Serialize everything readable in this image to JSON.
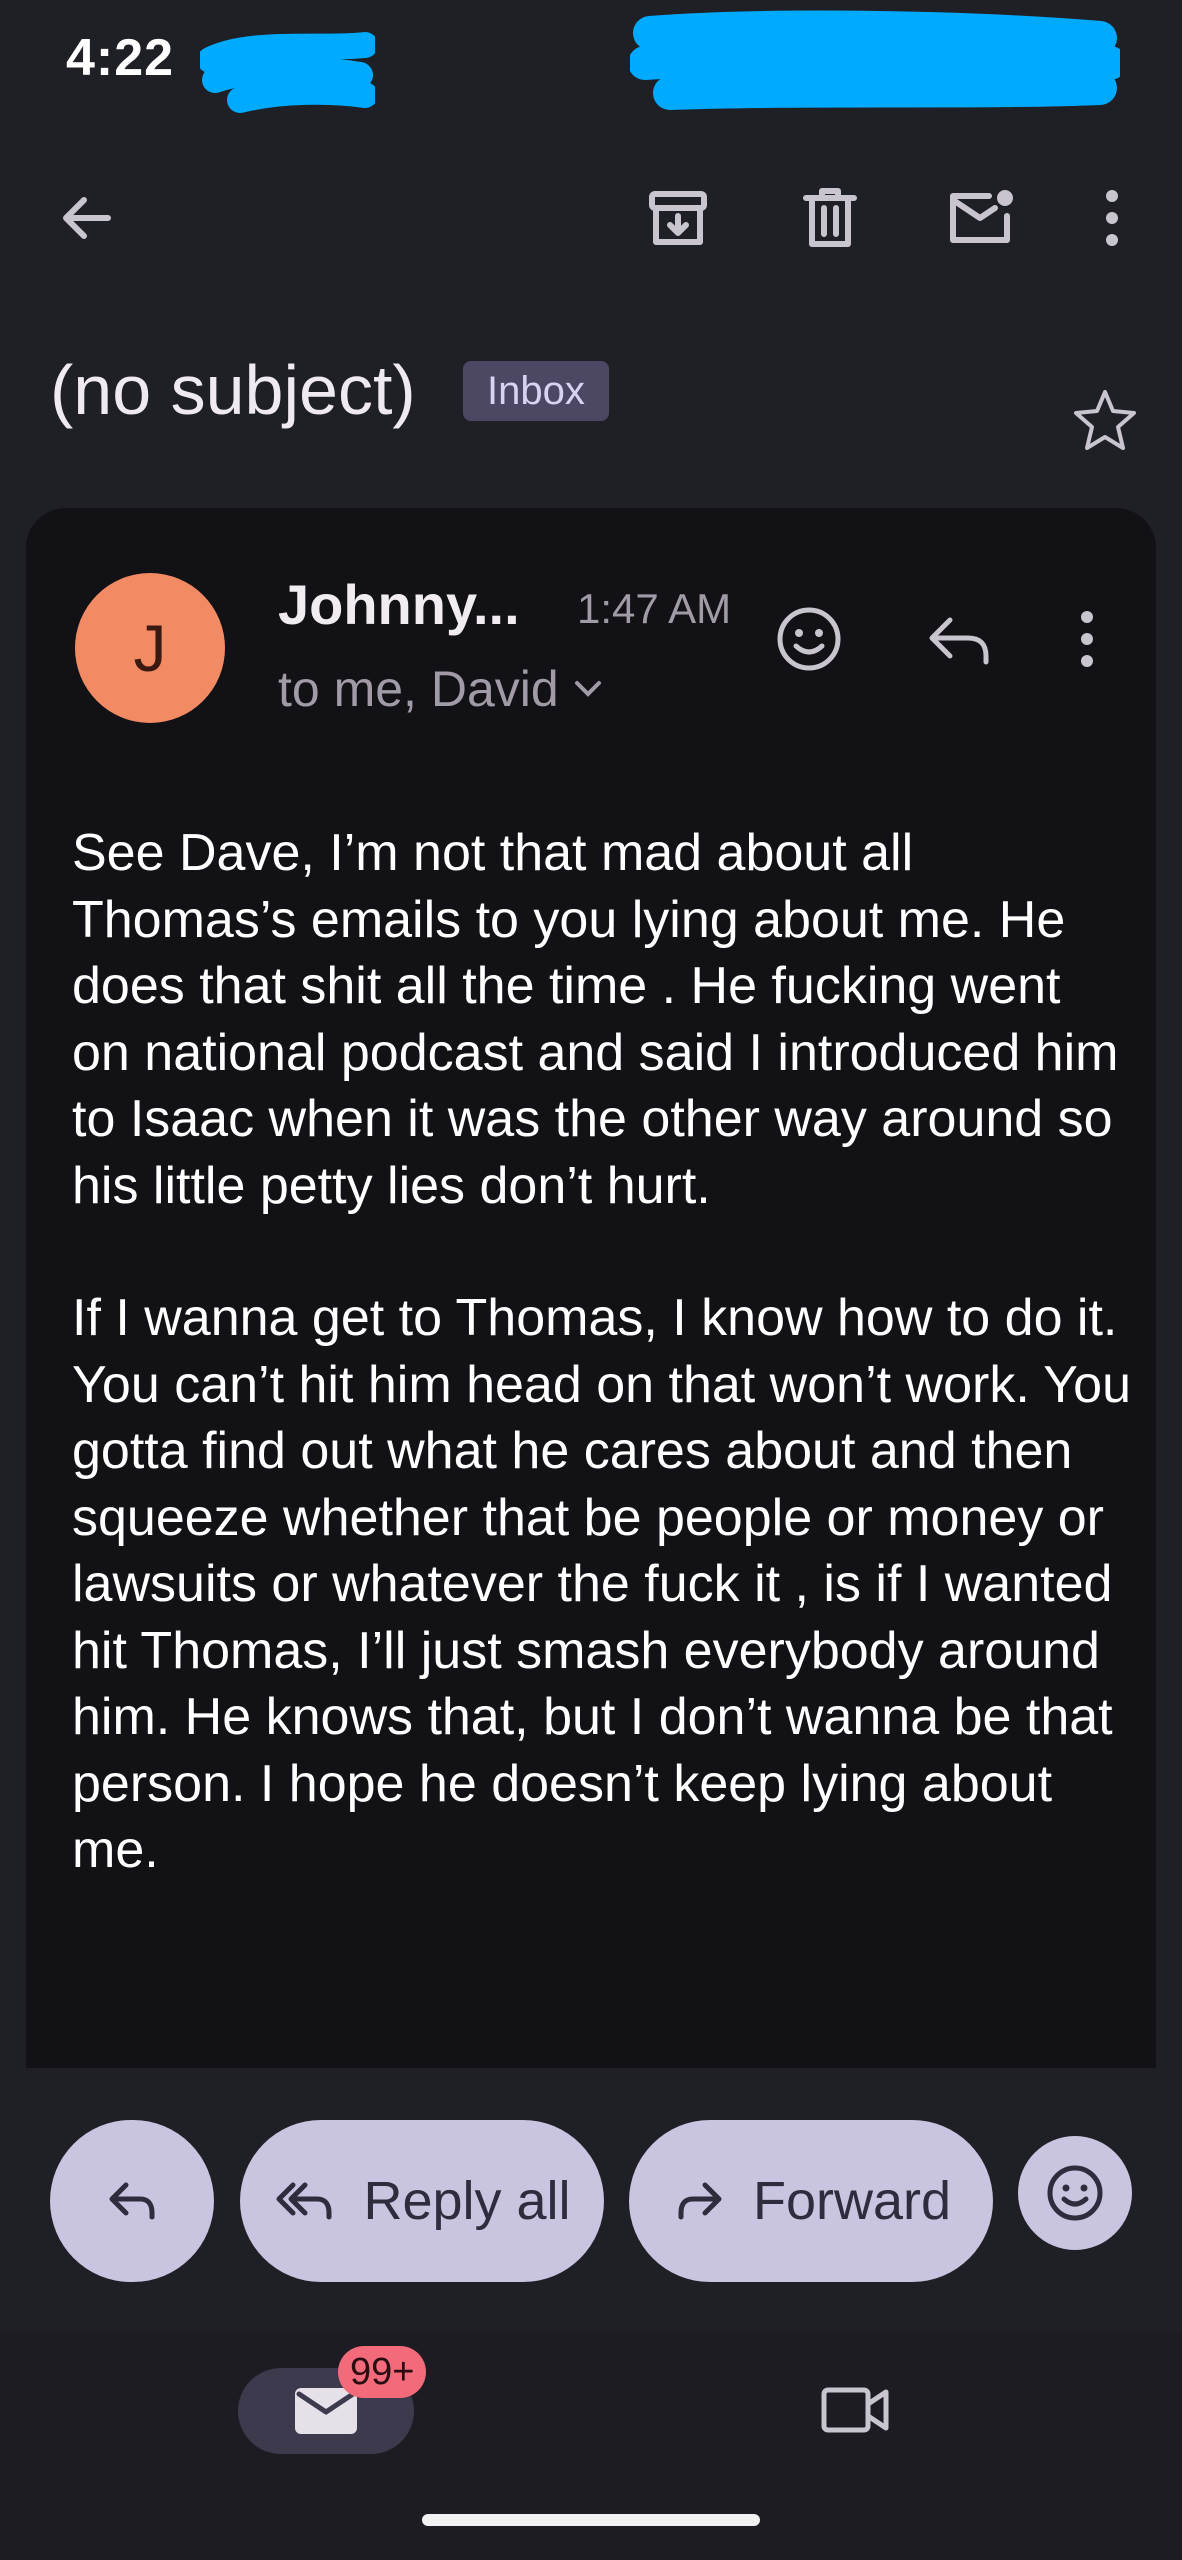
{
  "status_bar": {
    "time": "4:22"
  },
  "toolbar": {
    "back_icon": "arrow-back-icon",
    "archive_icon": "archive-icon",
    "delete_icon": "trash-icon",
    "mark_unread_icon": "mark-unread-icon",
    "more_icon": "more-vert-icon"
  },
  "email": {
    "subject": "(no subject)",
    "label": "Inbox",
    "sender_initial": "J",
    "sender": "Johnny...",
    "time": "1:47 AM",
    "recipients": "to me, David",
    "body": [
      "See Dave, I’m not that mad about all Thomas’s emails to you lying about me. He does that shit all the time . He fucking went on national podcast and said I introduced him to Isaac when it was the other way around so his little petty lies don’t hurt.",
      "If I wanna get to Thomas, I know how to do it. You can’t hit him head on that won’t work. You gotta find out what he cares about and then squeeze whether that be people or money or lawsuits or whatever the fuck it , is if I wanted hit Thomas, I’ll just smash everybody around him. He knows that, but I don’t wanna be that person. I hope he doesn’t keep lying about me."
    ]
  },
  "actions": {
    "reply_all": "Reply all",
    "forward": "Forward"
  },
  "bottom_nav": {
    "mail_badge": "99+"
  },
  "colors": {
    "background": "#1f1f26",
    "card": "#121116",
    "avatar": "#f28a63",
    "pill": "#c9c4e0",
    "badge": "#f36b7a",
    "redaction": "#00aaff"
  }
}
